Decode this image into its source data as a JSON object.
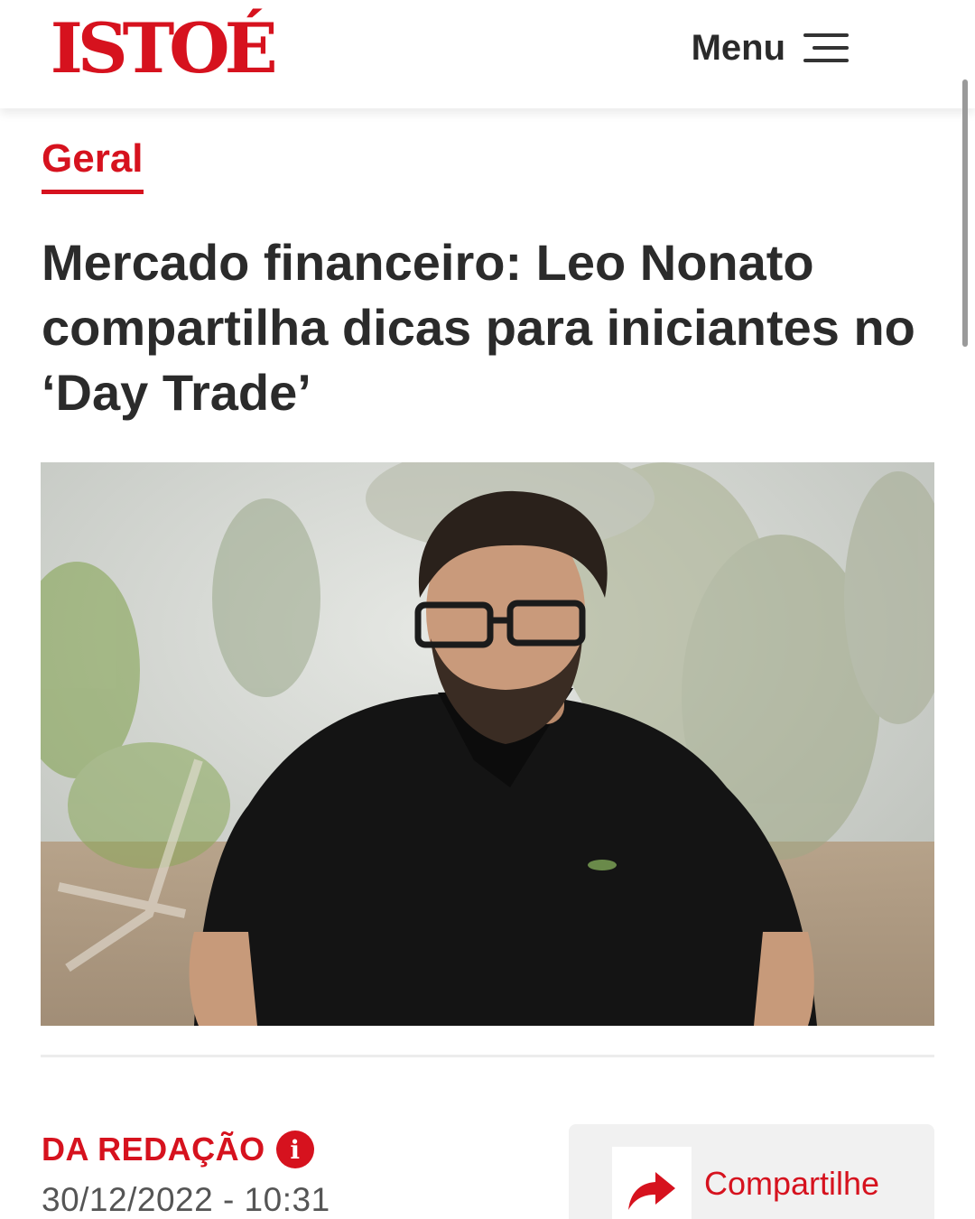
{
  "header": {
    "logo": "ISTOÉ",
    "menu_label": "Menu"
  },
  "article": {
    "category": "Geral",
    "title": "Mercado financeiro: Leo Nonato compartilha dicas para iniciantes no ‘Day Trade’",
    "author": "DA REDAÇÃO",
    "date": "30/12/2022 - 10:31",
    "share_label": "Compartilhe"
  },
  "icons": {
    "menu": "hamburger-icon",
    "info": "info-icon",
    "share": "share-arrow-icon"
  },
  "colors": {
    "brand": "#d6121e",
    "text": "#2b2b2b",
    "muted": "#555555"
  }
}
